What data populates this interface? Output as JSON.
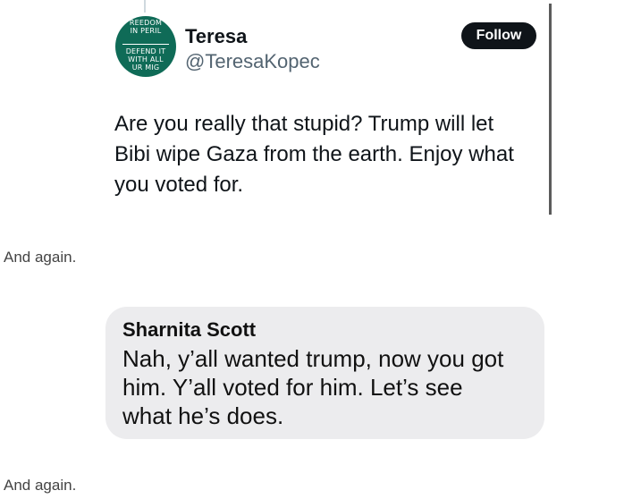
{
  "tweet": {
    "avatar": {
      "top_lines": [
        "REEDOM",
        "IN PERIL"
      ],
      "bottom_lines": [
        "DEFEND IT",
        "WITH ALL",
        "UR MIG"
      ]
    },
    "display_name": "Teresa",
    "handle": "@TeresaKopec",
    "follow_label": "Follow",
    "text_lines": [
      "Are you really that stupid? Trump will let",
      "Bibi wipe Gaza from the earth. Enjoy what",
      "you voted for."
    ]
  },
  "captions": [
    "And again.",
    "And again."
  ],
  "message": {
    "sender": "Sharnita Scott",
    "text_lines": [
      "Nah, y’all wanted trump, now you got",
      "him. Y’all voted for him. Let’s see",
      "what he’s does."
    ],
    "bubble_color": "#ececee"
  },
  "colors": {
    "follow_button": "#0f1419",
    "avatar": "#0f6b57",
    "handle": "#536471"
  }
}
